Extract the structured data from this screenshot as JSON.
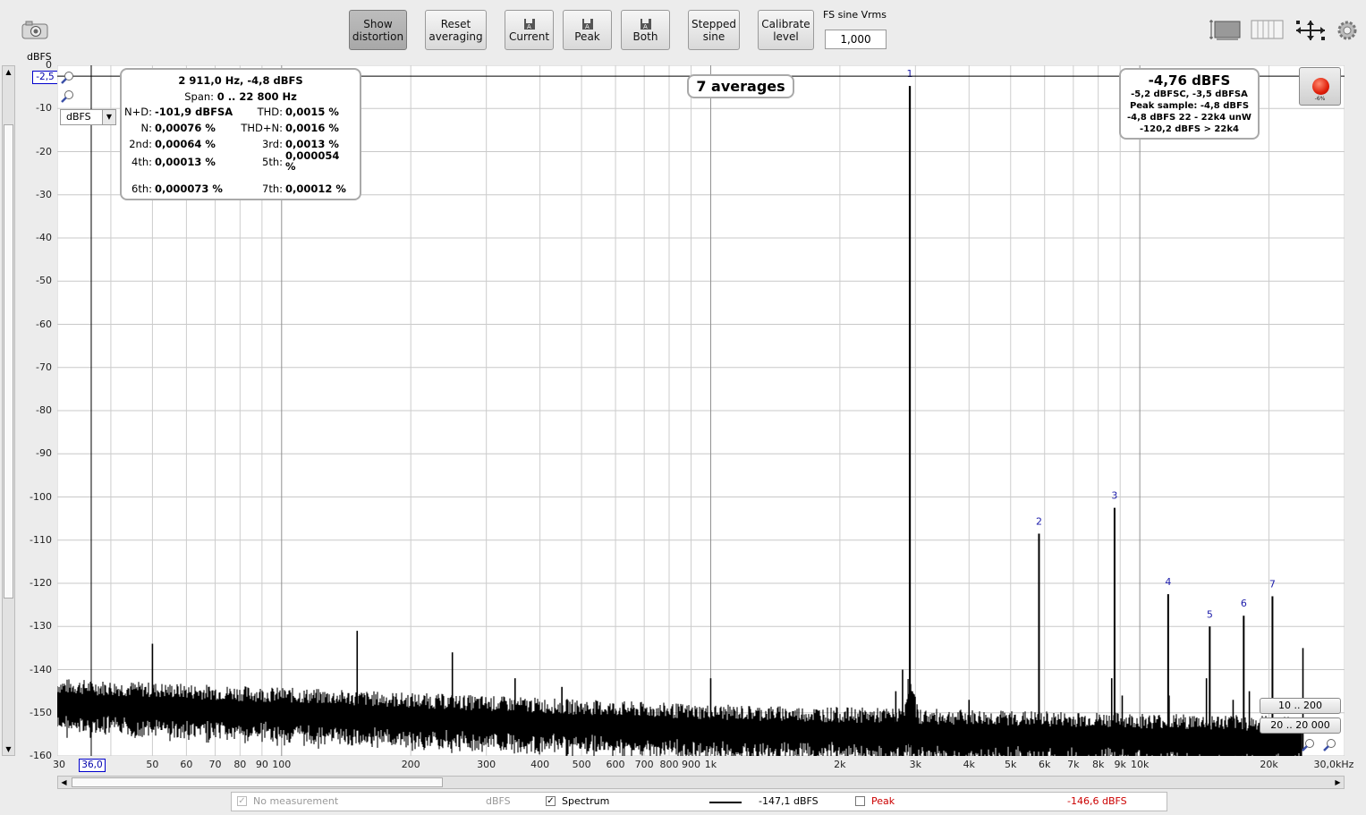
{
  "toolbar": {
    "show_distortion": [
      "Show",
      "distortion"
    ],
    "reset_averaging": [
      "Reset",
      "averaging"
    ],
    "save_current": "Current",
    "save_peak": "Peak",
    "save_both": "Both",
    "stepped_sine": [
      "Stepped",
      "sine"
    ],
    "calibrate_level": [
      "Calibrate",
      "level"
    ],
    "fs_sine_label": "FS sine Vrms",
    "fs_sine_value": "1,000"
  },
  "graph": {
    "y_unit": "dBFS",
    "y_top_value": "-2,5",
    "unit_select": "dBFS",
    "x_cursor_value": "36,0",
    "averages": "7 averages",
    "record_level": "-6%"
  },
  "distortion": {
    "header": "2 911,0 Hz, -4,8 dBFS",
    "span_label": "Span:",
    "span_value": "0 .. 22 800 Hz",
    "rows": [
      {
        "l1": "N+D:",
        "v1": "-101,9 dBFSA",
        "l2": "THD:",
        "v2": "0,0015 %"
      },
      {
        "l1": "N:",
        "v1": "0,00076 %",
        "l2": "THD+N:",
        "v2": "0,0016 %"
      },
      {
        "l1": "2nd:",
        "v1": "0,00064 %",
        "l2": "3rd:",
        "v2": "0,0013 %"
      },
      {
        "l1": "4th:",
        "v1": "0,00013 %",
        "l2": "5th:",
        "v2": "0,000054 %"
      },
      {
        "l1": "6th:",
        "v1": "0,000073 %",
        "l2": "7th:",
        "v2": "0,00012 %"
      }
    ]
  },
  "level_box": {
    "main": "-4,76 dBFS",
    "line1": "-5,2 dBFSC, -3,5 dBFSA",
    "line2": "Peak sample: -4,8 dBFS",
    "line3": "-4,8 dBFS 22 - 22k4 unW",
    "line4": "-120,2 dBFS > 22k4"
  },
  "range_buttons": [
    "10 .. 200",
    "20 .. 20 000"
  ],
  "legend": {
    "no_measurement": "No measurement",
    "no_measurement_unit": "dBFS",
    "spectrum": "Spectrum",
    "spectrum_value": "-147,1 dBFS",
    "peak": "Peak",
    "peak_value": "-146,6 dBFS",
    "peak_color": "#cc0000"
  },
  "chart_data": {
    "type": "line",
    "xscale": "log",
    "xlim": [
      30,
      30000
    ],
    "ylim": [
      -160,
      0
    ],
    "yticks": [
      0,
      -10,
      -20,
      -30,
      -40,
      -50,
      -60,
      -70,
      -80,
      -90,
      -100,
      -110,
      -120,
      -130,
      -140,
      -150,
      -160
    ],
    "xtick_labels": [
      {
        "f": 30,
        "t": "30"
      },
      {
        "f": 50,
        "t": "50"
      },
      {
        "f": 60,
        "t": "60"
      },
      {
        "f": 70,
        "t": "70"
      },
      {
        "f": 80,
        "t": "80"
      },
      {
        "f": 90,
        "t": "90"
      },
      {
        "f": 100,
        "t": "100"
      },
      {
        "f": 200,
        "t": "200"
      },
      {
        "f": 300,
        "t": "300"
      },
      {
        "f": 400,
        "t": "400"
      },
      {
        "f": 500,
        "t": "500"
      },
      {
        "f": 600,
        "t": "600"
      },
      {
        "f": 700,
        "t": "700"
      },
      {
        "f": 800,
        "t": "800"
      },
      {
        "f": 900,
        "t": "900"
      },
      {
        "f": 1000,
        "t": "1k"
      },
      {
        "f": 2000,
        "t": "2k"
      },
      {
        "f": 3000,
        "t": "3k"
      },
      {
        "f": 4000,
        "t": "4k"
      },
      {
        "f": 5000,
        "t": "5k"
      },
      {
        "f": 6000,
        "t": "6k"
      },
      {
        "f": 7000,
        "t": "7k"
      },
      {
        "f": 8000,
        "t": "8k"
      },
      {
        "f": 9000,
        "t": "9k"
      },
      {
        "f": 10000,
        "t": "10k"
      },
      {
        "f": 20000,
        "t": "20k"
      },
      {
        "f": 30000,
        "t": "30,0kHz"
      }
    ],
    "noise_floor_db": [
      -148,
      -154,
      -157
    ],
    "spikes": [
      {
        "f": 50,
        "db": -134
      },
      {
        "f": 150,
        "db": -131
      },
      {
        "f": 250,
        "db": -136
      },
      {
        "f": 350,
        "db": -142
      },
      {
        "f": 450,
        "db": -144
      },
      {
        "f": 1000,
        "db": -142
      },
      {
        "f": 1950,
        "db": -150
      },
      {
        "f": 2700,
        "db": -145
      },
      {
        "f": 2800,
        "db": -140
      },
      {
        "f": 4000,
        "db": -147
      },
      {
        "f": 8600,
        "db": -142
      },
      {
        "f": 9100,
        "db": -146
      },
      {
        "f": 11700,
        "db": -146
      },
      {
        "f": 14300,
        "db": -142
      },
      {
        "f": 16500,
        "db": -147
      },
      {
        "f": 18000,
        "db": -145
      },
      {
        "f": 24000,
        "db": -135
      }
    ],
    "harmonics": [
      {
        "n": "1",
        "f": 2911,
        "db": -4.8
      },
      {
        "n": "2",
        "f": 5822,
        "db": -108.5
      },
      {
        "n": "3",
        "f": 8733,
        "db": -102.5
      },
      {
        "n": "4",
        "f": 11644,
        "db": -122.5
      },
      {
        "n": "5",
        "f": 14555,
        "db": -130
      },
      {
        "n": "6",
        "f": 17466,
        "db": -127.5
      },
      {
        "n": "7",
        "f": 20377,
        "db": -123
      }
    ],
    "cursor": {
      "f": 36,
      "db": -2.5
    }
  }
}
